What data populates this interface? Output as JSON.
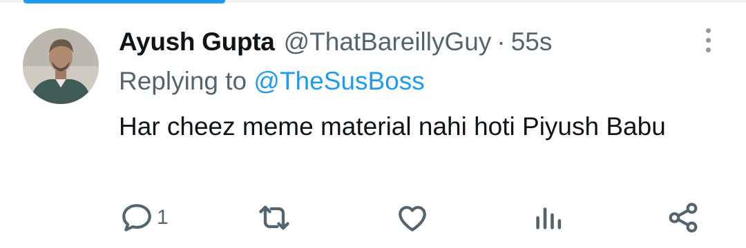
{
  "tweet": {
    "author_name": "Ayush Gupta",
    "author_handle": "@ThatBareillyGuy",
    "separator": "·",
    "timestamp": "55s",
    "replying_prefix": "Replying to",
    "replying_handle": "@TheSusBoss",
    "text": "Har cheez meme material nahi hoti Piyush Babu"
  },
  "actions": {
    "reply_count": "1"
  },
  "icons": [
    "reply-icon",
    "retweet-icon",
    "like-icon",
    "views-icon",
    "share-icon",
    "more-icon"
  ],
  "colors": {
    "accent": "#1d9bf0",
    "secondary_text": "#536471",
    "primary_text": "#0f1419"
  }
}
